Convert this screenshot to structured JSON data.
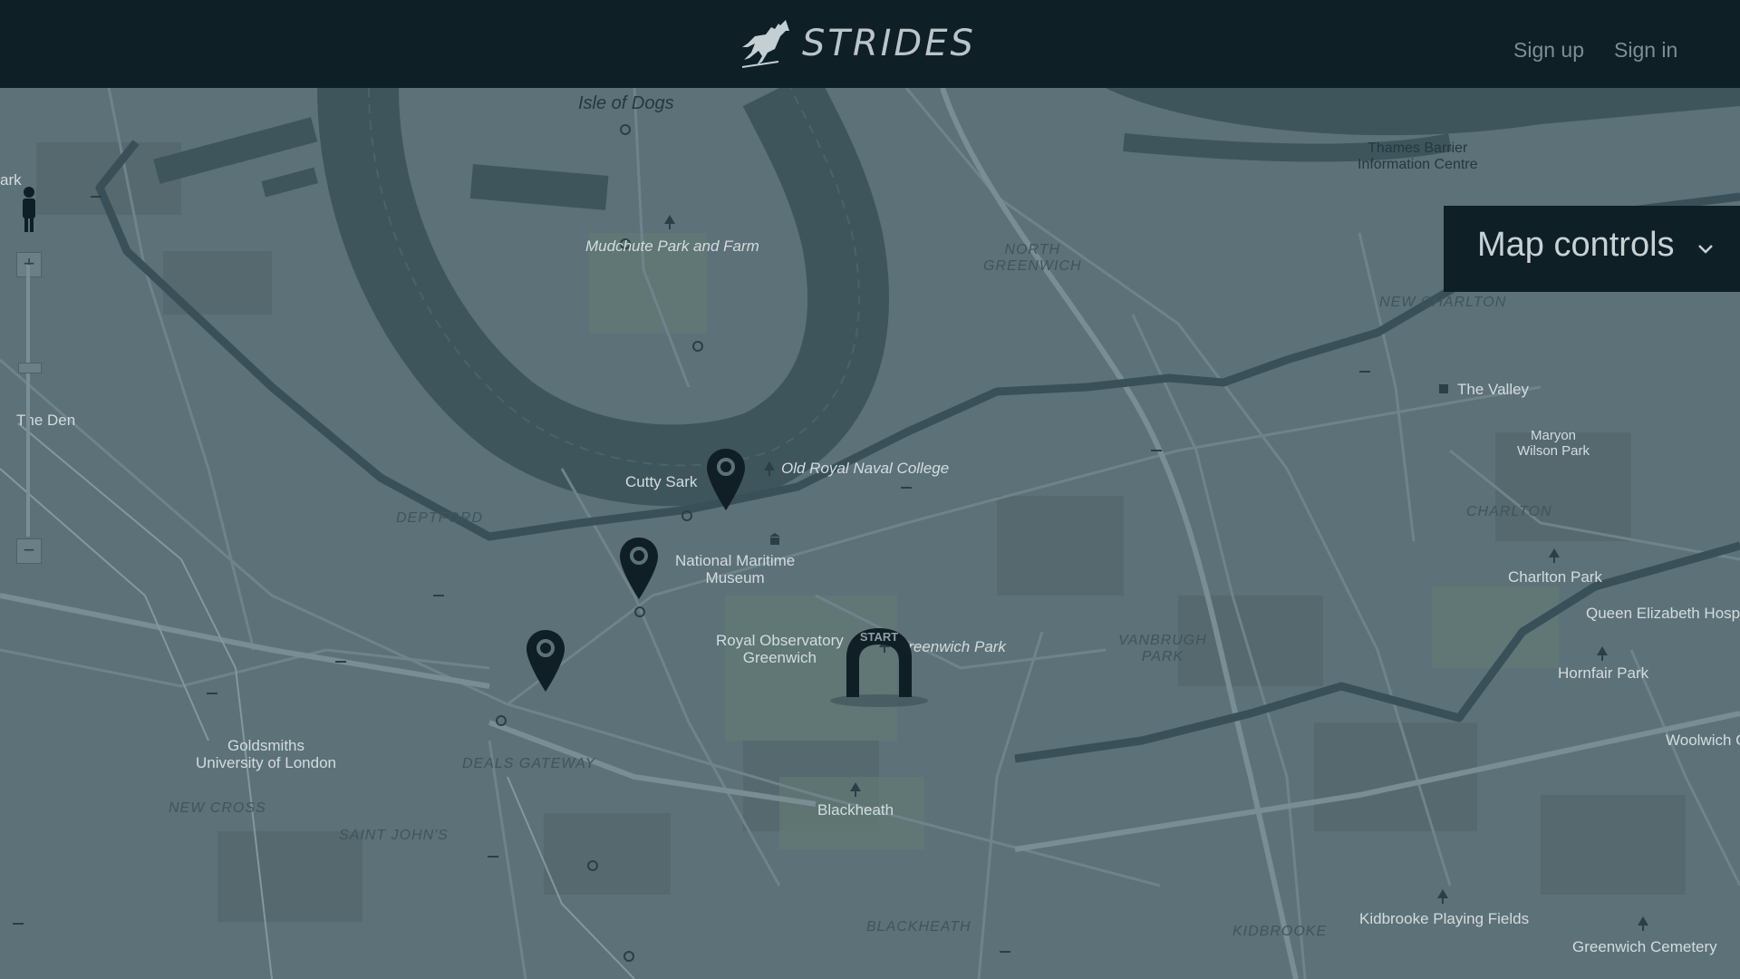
{
  "header": {
    "brand": "STRIDES",
    "sign_up": "Sign up",
    "sign_in": "Sign in"
  },
  "map_controls": {
    "title": "Map controls",
    "toggle_icon": "chevron-down-icon"
  },
  "zoom": {
    "plus": "+",
    "minus": "−"
  },
  "start_marker": {
    "label": "START"
  },
  "map_labels": {
    "isle_of_dogs": "Isle of Dogs",
    "mudchute": "Mudchute Park and Farm",
    "north_greenwich": "NORTH\nGREENWICH",
    "north_greenwich_1": "NORTH",
    "north_greenwich_2": "GREENWICH",
    "thames_barrier_1": "Thames Barrier",
    "thames_barrier_2": "Information Centre",
    "new_charlton": "NEW CHARLTON",
    "the_valley": "The Valley",
    "maryon_1": "Maryon",
    "maryon_2": "Wilson Park",
    "the_den": "The Den",
    "ark": "ark",
    "old_royal_naval": "Old Royal Naval College",
    "cutty_sark": "Cutty Sark",
    "deptford": "DEPTFORD",
    "national_maritime_1": "National Maritime",
    "national_maritime_2": "Museum",
    "charlton": "CHARLTON",
    "charlton_park": "Charlton Park",
    "queen_elizabeth": "Queen Elizabeth Hospi",
    "royal_observatory_1": "Royal Observatory",
    "royal_observatory_2": "Greenwich",
    "greenwich_park": "Greenwich Park",
    "vanbrugh_1": "VANBRUGH",
    "vanbrugh_2": "PARK",
    "hornfair": "Hornfair Park",
    "goldsmiths_1": "Goldsmiths",
    "goldsmiths_2": "University of London",
    "deals_gateway": "DEALS GATEWAY",
    "woolwich": "Woolwich C",
    "new_cross": "NEW CROSS",
    "saint_johns": "SAINT JOHN'S",
    "blackheath": "Blackheath",
    "blackheath_district": "BLACKHEATH",
    "kidbrooke": "KIDBROOKE",
    "kidbrooke_fields": "Kidbrooke Playing Fields",
    "greenwich_cemetery": "Greenwich Cemetery"
  },
  "colors": {
    "header_bg": "#0e1f26",
    "map_bg": "#5d7178",
    "river": "#3f555c",
    "route": "#3a5058",
    "marker": "#0f1f25"
  }
}
